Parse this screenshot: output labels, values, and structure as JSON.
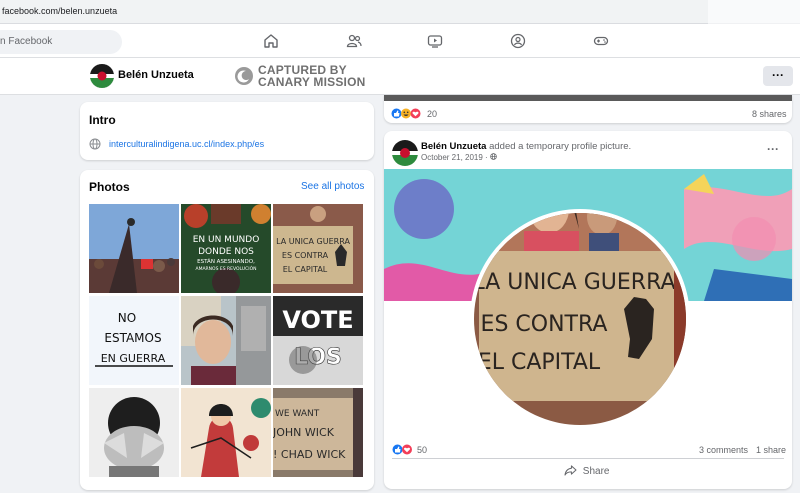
{
  "browser": {
    "url": "facebook.com/belen.unzueta"
  },
  "topnav": {
    "search_placeholder": "n Facebook",
    "icons": [
      "home-icon",
      "friends-icon",
      "watch-icon",
      "groups-icon",
      "gaming-icon"
    ]
  },
  "profile_bar": {
    "name": "Belén Unzueta",
    "watermark_line1": "CAPTURED BY",
    "watermark_line2": "CANARY MISSION",
    "more_label": "···"
  },
  "intro": {
    "title": "Intro",
    "link": "interculturalindigena.uc.cl/index.php/es"
  },
  "photos": {
    "title": "Photos",
    "see_all": "See all photos",
    "tiles": [
      {
        "name": "photo-protest-crowd"
      },
      {
        "name": "photo-en-un-mundo",
        "lines": [
          "EN UN MUNDO",
          "DONDE NOS",
          "ESTÁN ASESINANDO,",
          "AMARNOS ES REVOLUCIÓN"
        ]
      },
      {
        "name": "photo-unica-guerra",
        "lines": [
          "LA UNICA GUERRA",
          "ES CONTRA",
          "EL CAPITAL"
        ]
      },
      {
        "name": "photo-no-estamos",
        "lines": [
          "NO",
          "ESTAMOS",
          "EN GUERRA"
        ]
      },
      {
        "name": "photo-selfie"
      },
      {
        "name": "photo-vote",
        "lines": [
          "VOTE",
          "LOS"
        ]
      },
      {
        "name": "photo-hands-face"
      },
      {
        "name": "photo-illustration"
      },
      {
        "name": "photo-john-wick",
        "lines": [
          "WE WANT",
          "JOHN WICK",
          "! CHAD WICK"
        ]
      }
    ]
  },
  "previous_post": {
    "reaction_count": "20",
    "shares": "8 shares"
  },
  "post": {
    "author": "Belén Unzueta",
    "action": "added a temporary profile picture.",
    "date": "October 21, 2019 · ",
    "more_label": "···",
    "sign_lines": [
      "LA UNICA GUERRA",
      "ES CONTRA",
      "EL CAPITAL"
    ],
    "reaction_count": "50",
    "comments": "3 comments",
    "shares": "1 share",
    "share_label": "Share"
  },
  "colors": {
    "link_blue": "#1b74e4",
    "background": "#f0f2f5",
    "card": "#ffffff"
  }
}
